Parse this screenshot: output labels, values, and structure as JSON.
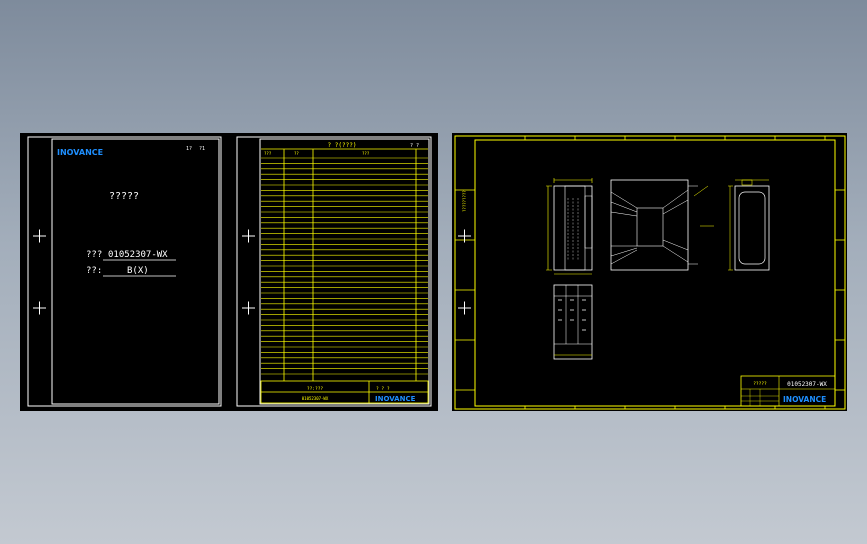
{
  "colors": {
    "background_top": "#7e8b9c",
    "background_bottom": "#c3c9d1",
    "sheet": "#000000",
    "frame": "#ffffff",
    "drawing_lines": "#ffff00",
    "brand": "#1e8fff",
    "text": "#ffffff"
  },
  "cover_sheet": {
    "brand": "INOVANCE",
    "page_mark_a": "1?",
    "page_mark_b": "?1",
    "doc_title": "?????",
    "part_label": "???",
    "part_number": "01052307-WX",
    "version_label": "??:",
    "version_value": "B(X)"
  },
  "revision_sheet": {
    "header_title": "? ?(???)",
    "page_mark": "? ?",
    "col_1": "???",
    "col_2": "??",
    "col_3": "???",
    "footer_label": "??:???",
    "footer_number": "01052307-WX",
    "footer_mark": "? ? ?",
    "brand": "INOVANCE"
  },
  "drawing_sheet": {
    "side_label": "?????????",
    "title_left": "?????",
    "part_number": "01052307-WX",
    "brand": "INOVANCE"
  }
}
